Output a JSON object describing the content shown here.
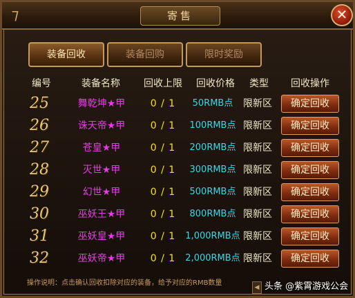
{
  "window": {
    "title": "寄售",
    "corner_glyph": "⁊",
    "close_glyph": "✕"
  },
  "tabs": [
    {
      "label": "装备回收",
      "active": true
    },
    {
      "label": "装备回购",
      "active": false
    },
    {
      "label": "限时奖励",
      "active": false
    }
  ],
  "table": {
    "headers": {
      "no": "编号",
      "name": "装备名称",
      "limit": "回收上限",
      "price": "回收价格",
      "type": "类型",
      "op": "回收操作"
    },
    "rows": [
      {
        "no": "25",
        "name": "舞乾坤★甲",
        "limit": "0 / 1",
        "price": "50RMB点",
        "type": "限新区",
        "btn": "确定回收"
      },
      {
        "no": "26",
        "name": "诛天帝★甲",
        "limit": "0 / 1",
        "price": "100RMB点",
        "type": "限新区",
        "btn": "确定回收"
      },
      {
        "no": "27",
        "name": "苍皇★甲",
        "limit": "0 / 1",
        "price": "200RMB点",
        "type": "限新区",
        "btn": "确定回收"
      },
      {
        "no": "28",
        "name": "灭世★甲",
        "limit": "0 / 1",
        "price": "300RMB点",
        "type": "限新区",
        "btn": "确定回收"
      },
      {
        "no": "29",
        "name": "幻世★甲",
        "limit": "0 / 1",
        "price": "500RMB点",
        "type": "限新区",
        "btn": "确定回收"
      },
      {
        "no": "30",
        "name": "巫妖王★甲",
        "limit": "0 / 1",
        "price": "800RMB点",
        "type": "限新区",
        "btn": "确定回收"
      },
      {
        "no": "31",
        "name": "巫妖皇★甲",
        "limit": "0 / 1",
        "price": "1,000RMB点",
        "type": "限新区",
        "btn": "确定回收"
      },
      {
        "no": "32",
        "name": "巫妖帝★甲",
        "limit": "0 / 1",
        "price": "2,000RMB点",
        "type": "限新区",
        "btn": "确定回收"
      }
    ]
  },
  "instructions": "操作说明：点击确认回收扣除对应的装备，给予对应的RMB数量",
  "scroll_glyph": "◀",
  "watermark": "头条 @紫霄游戏公会",
  "colors": {
    "item_name": "#e040e0",
    "limit": "#f4e020",
    "price": "#38d8e8",
    "number": "#e8c878"
  }
}
